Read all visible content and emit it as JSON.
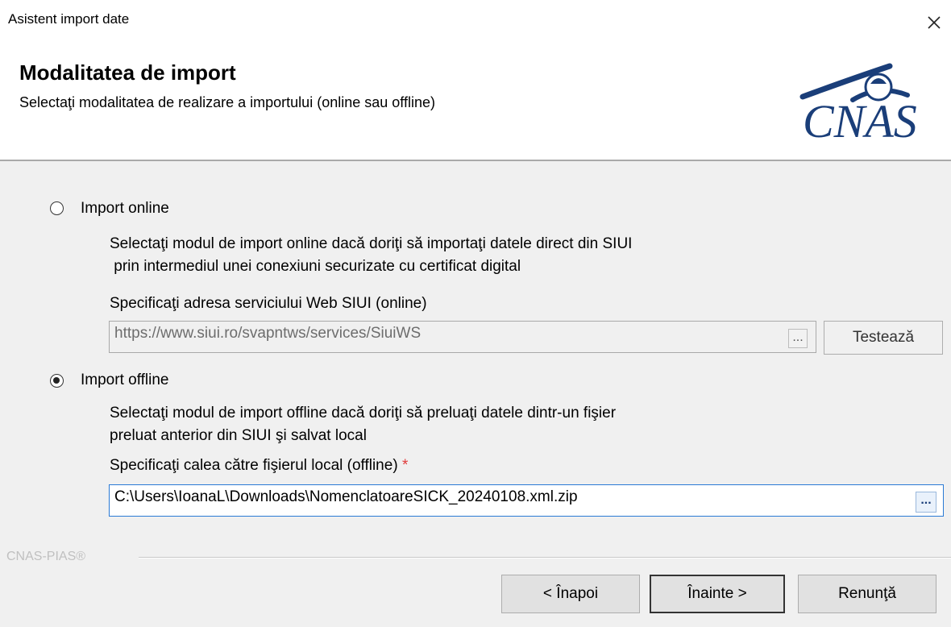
{
  "window": {
    "title": "Asistent import date",
    "close_icon": "close-icon"
  },
  "header": {
    "title": "Modalitatea de import",
    "subtitle": "Selectaţi modalitatea de realizare a importului (online sau offline)",
    "logo_text": "CNAS"
  },
  "online": {
    "label": "Import online",
    "selected": false,
    "description": "Selectaţi modul de import online dacă doriţi să importaţi datele direct din SIUI\n prin intermediul unei conexiuni securizate cu certificat digital",
    "field_label": "Specificaţi adresa serviciului Web SIUI (online)",
    "url_value": "https://www.siui.ro/svapntws/services/SiuiWS",
    "browse_label": "...",
    "test_button": "Testează"
  },
  "offline": {
    "label": "Import offline",
    "selected": true,
    "description": "Selectaţi modul de import offline dacă doriţi să preluaţi datele dintr-un fişier\npreluat anterior din SIUI şi salvat local",
    "field_label": "Specificaţi calea către fişierul local (offline)",
    "required_mark": "*",
    "path_value": "C:\\Users\\IoanaL\\Downloads\\NomenclatoareSICK_20240108.xml.zip",
    "browse_label": "..."
  },
  "footer": {
    "brand": "CNAS-PIAS®",
    "back_button": "< Înapoi",
    "next_button": "Înainte >",
    "cancel_button": "Renunţă"
  },
  "colors": {
    "accent": "#1a3e79",
    "required": "#e03a3a",
    "panel": "#f0f0f0",
    "focus_border": "#2a7ad5"
  }
}
